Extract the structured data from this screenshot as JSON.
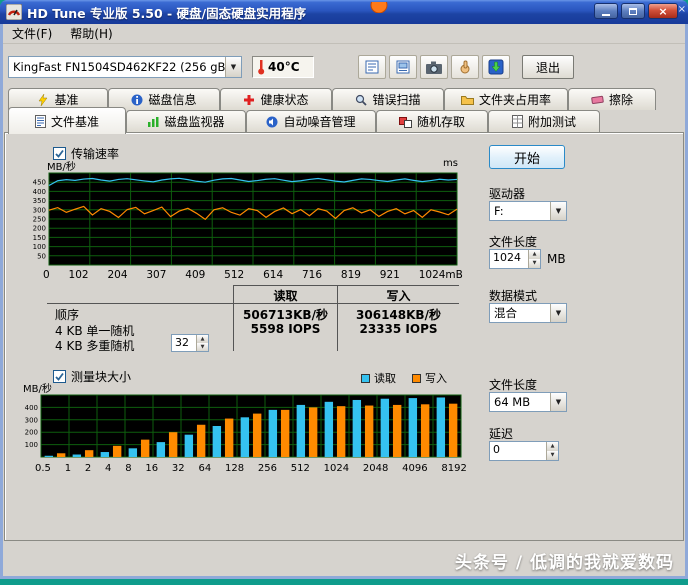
{
  "window": {
    "title": "HD Tune 专业版 5.50 - 硬盘/固态硬盘实用程序",
    "menu": [
      "文件(F)",
      "帮助(H)"
    ]
  },
  "toolbar": {
    "drive": "KingFast FN1504SD462KF22 (256 gB)",
    "temperature": "40°C",
    "exit_label": "退出"
  },
  "tabs": {
    "row1": [
      "基准",
      "磁盘信息",
      "健康状态",
      "错误扫描",
      "文件夹占用率",
      "擦除"
    ],
    "row2": [
      "文件基准",
      "磁盘监视器",
      "自动噪音管理",
      "随机存取",
      "附加测试"
    ],
    "active": "文件基准"
  },
  "panel": {
    "transfer_rate_label": "传输速率",
    "block_size_label": "测量块大小"
  },
  "results": {
    "read_header": "读取",
    "write_header": "写入",
    "rows": [
      {
        "label": "顺序",
        "read": "506713KB/秒",
        "write": "306148KB/秒"
      },
      {
        "label": "4 KB 单一随机",
        "read": "5598 IOPS",
        "write": "23335 IOPS"
      },
      {
        "label": "4 KB 多重随机",
        "read": "",
        "write": "",
        "queue_depth": "32"
      }
    ]
  },
  "sidebar": {
    "start_label": "开始",
    "drive_label": "驱动器",
    "drive_value": "F:",
    "file_length_label": "文件长度",
    "file_length_value": "1024",
    "file_length_unit": "MB",
    "data_mode_label": "数据模式",
    "data_mode_value": "混合",
    "file_length2_label": "文件长度",
    "file_length2_value": "64 MB",
    "delay_label": "延迟",
    "delay_value": "0"
  },
  "watermark": "头条号 / 低调的我就爱数码",
  "chart_data": [
    {
      "type": "line",
      "title": "传输速率",
      "ylabel": "MB/秒",
      "ylabel_right": "ms",
      "ylim": [
        0,
        500
      ],
      "ytick_step": 50,
      "grid": true,
      "bg": "#000000",
      "grid_color": "#0e5e0e",
      "x_tick_labels": [
        "0",
        "102",
        "204",
        "307",
        "409",
        "512",
        "614",
        "716",
        "819",
        "921",
        "1024mB"
      ],
      "series": [
        {
          "name": "读取",
          "color": "#35c2f0",
          "values": [
            432,
            458,
            464,
            460,
            467,
            470,
            462,
            456,
            465,
            469,
            463,
            457,
            452,
            462,
            468,
            471,
            464,
            455,
            450,
            461,
            468,
            470,
            462,
            454,
            459,
            466,
            469,
            461,
            453,
            458,
            465,
            470,
            463,
            456,
            451,
            460,
            468,
            465,
            459,
            454,
            462,
            468,
            460,
            453,
            459,
            466,
            462,
            465
          ]
        },
        {
          "name": "写入",
          "color": "#ff8a00",
          "values": [
            298,
            312,
            286,
            303,
            318,
            272,
            306,
            291,
            258,
            301,
            313,
            278,
            296,
            315,
            263,
            293,
            308,
            281,
            248,
            300,
            311,
            286,
            271,
            306,
            296,
            259,
            291,
            310,
            279,
            301,
            268,
            306,
            293,
            253,
            296,
            311,
            283,
            300,
            264,
            291,
            306,
            278,
            296,
            259,
            300,
            288,
            273,
            304
          ]
        }
      ]
    },
    {
      "type": "bar",
      "title": "测量块大小",
      "ylabel": "MB/秒",
      "ylim": [
        0,
        500
      ],
      "ytick_step": 100,
      "grid": true,
      "bg": "#000000",
      "grid_color": "#0e5e0e",
      "legend_position": "top-right",
      "categories": [
        "0.5",
        "1",
        "2",
        "4",
        "8",
        "16",
        "32",
        "64",
        "128",
        "256",
        "512",
        "1024",
        "2048",
        "4096",
        "8192"
      ],
      "series": [
        {
          "name": "读取",
          "color": "#35c2f0",
          "values": [
            10,
            20,
            40,
            70,
            120,
            180,
            250,
            320,
            380,
            420,
            445,
            460,
            470,
            475,
            480
          ]
        },
        {
          "name": "写入",
          "color": "#ff8a00",
          "values": [
            30,
            55,
            90,
            140,
            200,
            260,
            310,
            350,
            380,
            400,
            410,
            415,
            420,
            425,
            430
          ]
        }
      ]
    }
  ]
}
